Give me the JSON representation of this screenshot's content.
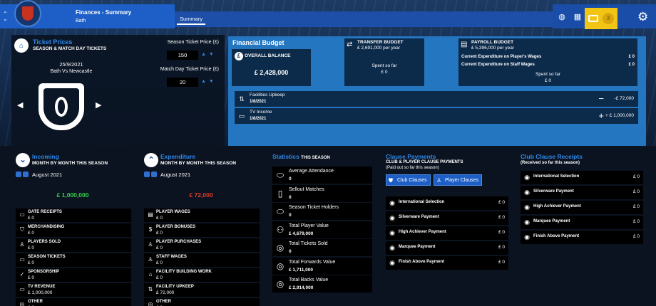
{
  "header": {
    "title": "Finances - Summary",
    "subtitle": "Bath",
    "tab_summary": "Summary",
    "inbox_count": "3"
  },
  "tickets": {
    "title": "Ticket Prices",
    "subtitle": "SEASON & MATCH DAY TICKETS",
    "match_date": "25/9/2021",
    "match_name": "Bath Vs Newcastle",
    "season_label": "Season Ticket Price (£)",
    "season_value": "150",
    "matchday_label": "Match Day Ticket Price (£)",
    "matchday_value": "20"
  },
  "budget": {
    "title": "Financial Budget",
    "overall_label": "OVERALL BALANCE",
    "overall_value": "£ 2,428,000",
    "transfer_label": "TRANSFER BUDGET",
    "transfer_value": "£ 2,691,000 per year",
    "transfer_spent_label": "Spent so far",
    "transfer_spent_value": "£ 0",
    "payroll_label": "PAYROLL BUDGET",
    "payroll_value": "£ 5,396,000 per year",
    "payroll_players_label": "Current Expenditure on Player's Wages",
    "payroll_players_value": "£ 0",
    "payroll_staff_label": "Current Expenditure on Staff Wages",
    "payroll_staff_value": "£ 0",
    "payroll_spent_label": "Spent so far",
    "payroll_spent_value": "£ 0",
    "rows": [
      {
        "label": "Facilities Upkeep",
        "date": "1/8/2021",
        "op": "−",
        "value": "-£ 72,000"
      },
      {
        "label": "TV Income",
        "date": "1/8/2021",
        "op": "+",
        "value": "+ £ 1,000,000"
      }
    ]
  },
  "incoming": {
    "title": "Incoming",
    "subtitle": "MONTH BY MONTH THIS SEASON",
    "month": "August 2021",
    "total": "£ 1,000,000",
    "total_color": "#37d24a",
    "items": [
      {
        "label": "GATE RECEIPTS",
        "value": "£ 0",
        "icon": "ticket-icon"
      },
      {
        "label": "MERCHANDISING",
        "value": "£ 0",
        "icon": "shirt-icon"
      },
      {
        "label": "PLAYERS SOLD",
        "value": "£ 0",
        "icon": "player-icon"
      },
      {
        "label": "SEASON TICKETS",
        "value": "£ 0",
        "icon": "ticket-icon"
      },
      {
        "label": "SPONSORSHIP",
        "value": "£ 0",
        "icon": "handshake-icon"
      },
      {
        "label": "TV REVENUE",
        "value": "£ 1,000,000",
        "icon": "tv-icon"
      },
      {
        "label": "OTHER",
        "value": "£ 0",
        "icon": "coin-icon"
      }
    ]
  },
  "expenditure": {
    "title": "Expenditure",
    "subtitle": "MONTH BY MONTH THIS SEASON",
    "month": "August 2021",
    "total": "£ 72,000",
    "total_color": "#e83a2a",
    "items": [
      {
        "label": "PLAYER WAGES",
        "value": "£ 0",
        "icon": "money-icon"
      },
      {
        "label": "PLAYER BONUSES",
        "value": "£ 0",
        "icon": "bonus-icon"
      },
      {
        "label": "PLAYER PURCHASES",
        "value": "£ 0",
        "icon": "player-icon"
      },
      {
        "label": "STAFF WAGES",
        "value": "£ 0",
        "icon": "staff-icon"
      },
      {
        "label": "FACILITY BUILDING WORK",
        "value": "£ 0",
        "icon": "building-icon"
      },
      {
        "label": "FACILITY UPKEEP",
        "value": "£ 72,000",
        "icon": "upkeep-icon"
      },
      {
        "label": "OTHER",
        "value": "£ 0",
        "icon": "coin-icon"
      }
    ]
  },
  "statistics": {
    "title": "Statistics",
    "title_suffix": "THIS SEASON",
    "items": [
      {
        "label": "Average Attendance",
        "value": "0",
        "icon": "stadium-icon"
      },
      {
        "label": "Sellout Matches",
        "value": "0",
        "icon": "seat-icon"
      },
      {
        "label": "Season Ticket Holders",
        "value": "0",
        "icon": "stadium-icon"
      },
      {
        "label": "Total Player Value",
        "value": "£ 4,679,000",
        "icon": "players-icon"
      },
      {
        "label": "Total Tickets Sold",
        "value": "0",
        "icon": "coin-icon"
      },
      {
        "label": "Total Forwards Value",
        "value": "£ 1,711,000",
        "icon": "coin-icon"
      },
      {
        "label": "Total Backs Value",
        "value": "£ 2,914,000",
        "icon": "coin-icon"
      }
    ]
  },
  "clause_payments": {
    "title": "Clause Payments",
    "subtitle": "CLUB & PLAYER CLAUSE PAYMENTS",
    "note": "(Paid out so far this season)",
    "btn_club": "Club Clauses",
    "btn_player": "Player Clauses",
    "items": [
      {
        "label": "International Selection",
        "value": "£ 0"
      },
      {
        "label": "Silverware Payment",
        "value": "£ 0"
      },
      {
        "label": "High Achiever Payment",
        "value": "£ 0"
      },
      {
        "label": "Marquee Payment",
        "value": "£ 0"
      },
      {
        "label": "Finish Above Payment",
        "value": "£ 0"
      }
    ]
  },
  "clause_receipts": {
    "title": "Club Clause Receipts",
    "note": "(Received so far this season)",
    "items": [
      {
        "label": "International Selection",
        "value": "£ 0"
      },
      {
        "label": "Silverware Payment",
        "value": "£ 0"
      },
      {
        "label": "High Achiever Payment",
        "value": "£ 0"
      },
      {
        "label": "Marquee Payment",
        "value": "£ 0"
      },
      {
        "label": "Finish Above Payment",
        "value": "£ 0"
      }
    ]
  }
}
